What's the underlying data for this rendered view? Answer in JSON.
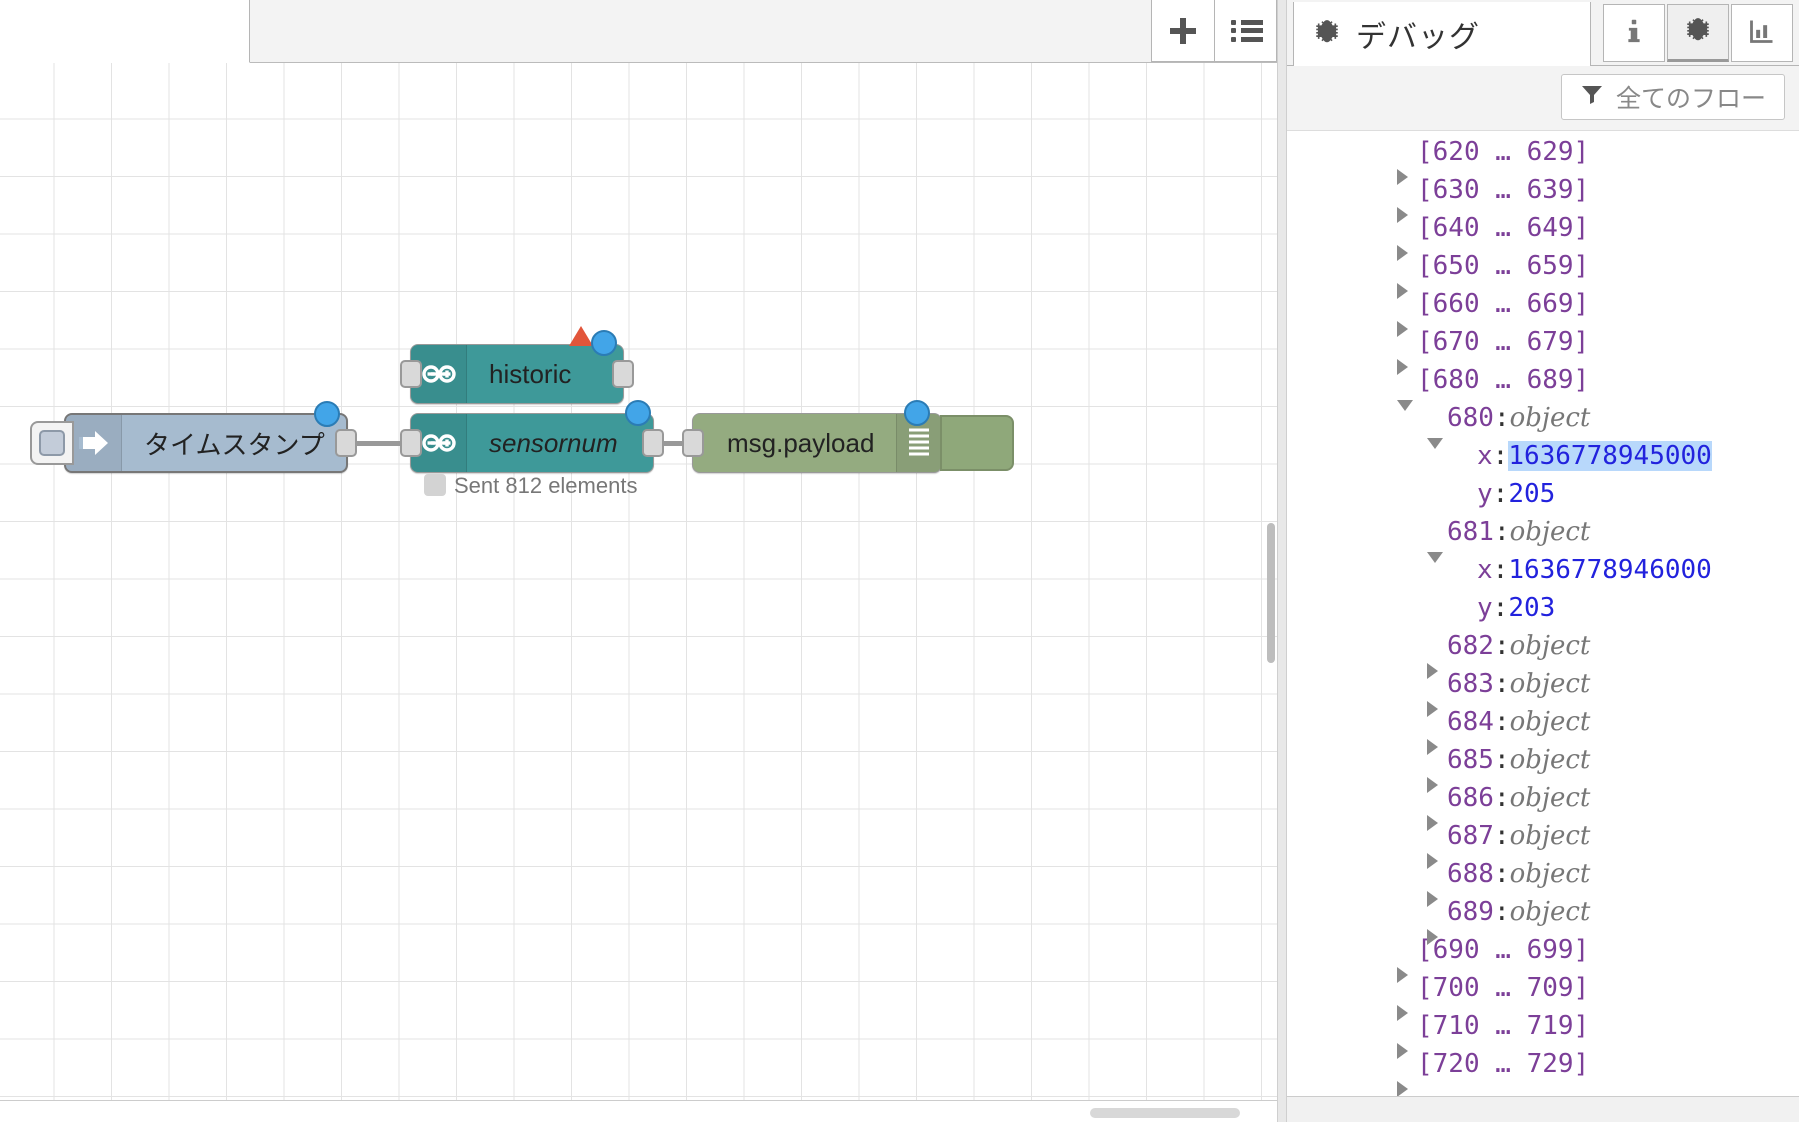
{
  "editor": {
    "tab": {
      "label": ""
    },
    "toolbar": {
      "add_label": "",
      "add_icon": "plus-icon",
      "list_label": "",
      "list_icon": "list-icon"
    },
    "nodes": [
      {
        "id": "inject",
        "name": "timestamp-inject-node",
        "label": "タイムスタンプ",
        "icon": "inject-arrow-icon",
        "color": "#a6bbcf",
        "italic": false,
        "selected": true
      },
      {
        "id": "historic",
        "name": "historic-node",
        "label": "historic",
        "icon": "arduino-infinity-icon",
        "color": "#3e9999",
        "italic": false,
        "selected": false,
        "warning": true
      },
      {
        "id": "sensornum",
        "name": "sensornum-node",
        "label": "sensornum",
        "icon": "arduino-infinity-icon",
        "color": "#3e9999",
        "italic": true,
        "selected": false,
        "status": "Sent 812 elements"
      },
      {
        "id": "debugnode",
        "name": "msg-payload-debug-node",
        "label": "msg.payload",
        "icon": "debug-lines-icon",
        "color": "#94ab80",
        "italic": false,
        "selected": false
      }
    ]
  },
  "sidebar": {
    "title": "デバッグ",
    "title_icon": "bug-icon",
    "tabs": [
      {
        "name": "info",
        "icon": "info-icon",
        "active": false
      },
      {
        "name": "debug",
        "icon": "bug-icon",
        "active": true
      },
      {
        "name": "chart",
        "icon": "chart-icon",
        "active": false
      }
    ],
    "filter": {
      "label": "全てのフロー",
      "icon": "funnel-icon"
    },
    "tree": [
      {
        "indent": 0,
        "state": "collapsed",
        "kind": "range",
        "label": "[620 … 629]"
      },
      {
        "indent": 0,
        "state": "collapsed",
        "kind": "range",
        "label": "[630 … 639]"
      },
      {
        "indent": 0,
        "state": "collapsed",
        "kind": "range",
        "label": "[640 … 649]"
      },
      {
        "indent": 0,
        "state": "collapsed",
        "kind": "range",
        "label": "[650 … 659]"
      },
      {
        "indent": 0,
        "state": "collapsed",
        "kind": "range",
        "label": "[660 … 669]"
      },
      {
        "indent": 0,
        "state": "collapsed",
        "kind": "range",
        "label": "[670 … 679]"
      },
      {
        "indent": 0,
        "state": "expanded",
        "kind": "range",
        "label": "[680 … 689]"
      },
      {
        "indent": 1,
        "state": "expanded",
        "kind": "object",
        "key": "680",
        "value": "object"
      },
      {
        "indent": 2,
        "state": "none",
        "kind": "prop",
        "key": "x",
        "value": "1636778945000",
        "selected": true
      },
      {
        "indent": 2,
        "state": "none",
        "kind": "prop",
        "key": "y",
        "value": "205",
        "selected": false
      },
      {
        "indent": 1,
        "state": "expanded",
        "kind": "object",
        "key": "681",
        "value": "object"
      },
      {
        "indent": 2,
        "state": "none",
        "kind": "prop",
        "key": "x",
        "value": "1636778946000",
        "selected": false
      },
      {
        "indent": 2,
        "state": "none",
        "kind": "prop",
        "key": "y",
        "value": "203",
        "selected": false
      },
      {
        "indent": 1,
        "state": "collapsed",
        "kind": "object",
        "key": "682",
        "value": "object"
      },
      {
        "indent": 1,
        "state": "collapsed",
        "kind": "object",
        "key": "683",
        "value": "object"
      },
      {
        "indent": 1,
        "state": "collapsed",
        "kind": "object",
        "key": "684",
        "value": "object"
      },
      {
        "indent": 1,
        "state": "collapsed",
        "kind": "object",
        "key": "685",
        "value": "object"
      },
      {
        "indent": 1,
        "state": "collapsed",
        "kind": "object",
        "key": "686",
        "value": "object"
      },
      {
        "indent": 1,
        "state": "collapsed",
        "kind": "object",
        "key": "687",
        "value": "object"
      },
      {
        "indent": 1,
        "state": "collapsed",
        "kind": "object",
        "key": "688",
        "value": "object"
      },
      {
        "indent": 1,
        "state": "collapsed",
        "kind": "object",
        "key": "689",
        "value": "object"
      },
      {
        "indent": 0,
        "state": "collapsed",
        "kind": "range",
        "label": "[690 … 699]"
      },
      {
        "indent": 0,
        "state": "collapsed",
        "kind": "range",
        "label": "[700 … 709]"
      },
      {
        "indent": 0,
        "state": "collapsed",
        "kind": "range",
        "label": "[710 … 719]"
      },
      {
        "indent": 0,
        "state": "collapsed",
        "kind": "range",
        "label": "[720 … 729]"
      }
    ]
  },
  "colors": {
    "node_teal": "#3e9999",
    "node_green": "#94ab80",
    "node_blue_grey": "#a6bbcf",
    "selection_dot": "#42a5e8",
    "warning": "#e2553a",
    "json_key": "#7c3f98",
    "json_number": "#2222dd",
    "highlight": "#b8d8fb"
  }
}
